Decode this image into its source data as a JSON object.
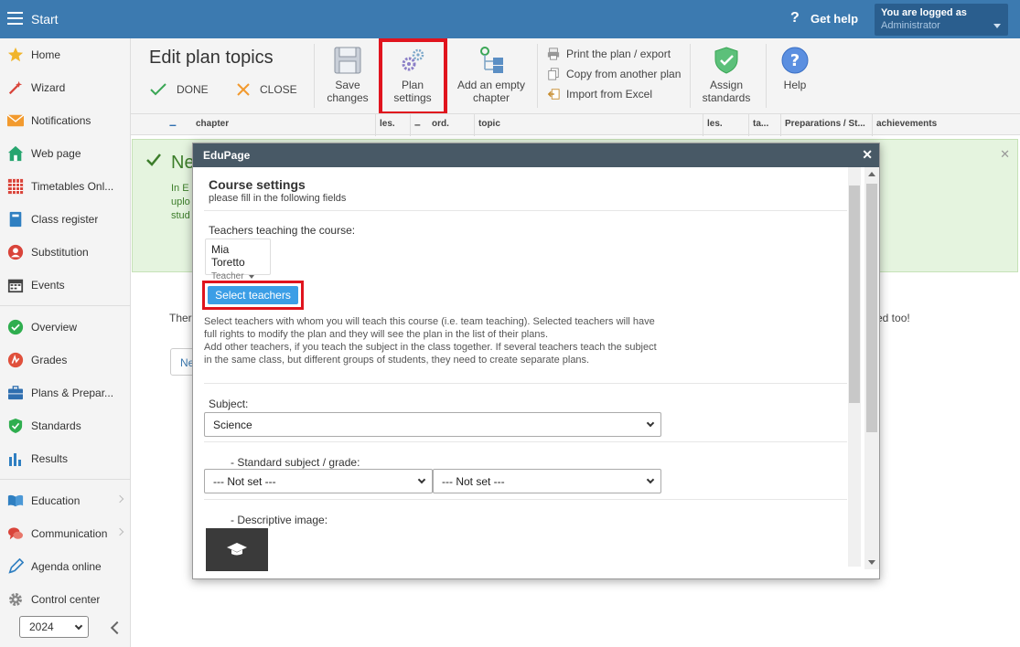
{
  "topbar": {
    "start_label": "Start",
    "help_label": "Get help",
    "logged_in_label": "You are logged as",
    "logged_in_user": "Administrator"
  },
  "sidebar": {
    "items": [
      {
        "label": "Home",
        "icon": "star-icon"
      },
      {
        "label": "Wizard",
        "icon": "wand-icon"
      },
      {
        "label": "Notifications",
        "icon": "envelope-icon"
      },
      {
        "label": "Web page",
        "icon": "house-icon"
      },
      {
        "label": "Timetables Onl...",
        "icon": "grid-icon"
      },
      {
        "label": "Class register",
        "icon": "book-icon"
      },
      {
        "label": "Substitution",
        "icon": "person-icon"
      },
      {
        "label": "Events",
        "icon": "calendar-icon"
      },
      {
        "label": "Overview",
        "icon": "check-circle-icon"
      },
      {
        "label": "Grades",
        "icon": "grade-icon"
      },
      {
        "label": "Plans & Prepar...",
        "icon": "briefcase-icon"
      },
      {
        "label": "Standards",
        "icon": "shield-icon"
      },
      {
        "label": "Results",
        "icon": "bar-chart-icon"
      },
      {
        "label": "Education",
        "icon": "open-book-icon"
      },
      {
        "label": "Communication",
        "icon": "chat-icon"
      },
      {
        "label": "Agenda online",
        "icon": "pen-icon"
      },
      {
        "label": "Control center",
        "icon": "gear-icon"
      }
    ],
    "year": "2024"
  },
  "toolbar": {
    "title": "Edit plan topics",
    "done_label": "DONE",
    "close_label": "CLOSE",
    "save_label_1": "Save",
    "save_label_2": "changes",
    "plan_label_1": "Plan",
    "plan_label_2": "settings",
    "add_label_1": "Add an empty",
    "add_label_2": "chapter",
    "print_label": "Print the plan / export",
    "copy_label": "Copy from another plan",
    "import_label": "Import from Excel",
    "assign_label_1": "Assign",
    "assign_label_2": "standards",
    "help_label": "Help"
  },
  "table_header": {
    "collapse": "–",
    "chapter": "chapter",
    "les1": "les.",
    "ord_minus": "–",
    "ord": "ord.",
    "topic": "topic",
    "les2": "les.",
    "ta": "ta...",
    "preparations": "Preparations / St...",
    "achievements": "achievements"
  },
  "background": {
    "notice_title": "Ne",
    "notice_line1": "In E",
    "notice_line2": "uplo",
    "notice_line3": "stud",
    "there_text": "Ther",
    "too_text": "ed too!",
    "new_btn": "Ne"
  },
  "modal": {
    "header": "EduPage",
    "title": "Course settings",
    "subtitle": "please fill in the following fields",
    "teachers_label": "Teachers teaching the course:",
    "teacher_name": "Mia Toretto",
    "teacher_role": "Teacher",
    "select_teachers_label": "Select teachers",
    "help_text_1": "Select teachers with whom you will teach this course (i.e. team teaching). Selected teachers will have full rights to modify the plan and they will see the plan in the list of their plans.",
    "help_text_2": "Add other teachers, if you teach the subject in the class together. If several teachers teach the subject in the same class, but different groups of students, they need to create separate plans.",
    "subject_label": "Subject:",
    "subject_value": "Science",
    "standard_label": "- Standard subject / grade:",
    "standard_value_1": "--- Not set ---",
    "standard_value_2": "--- Not set ---",
    "image_label": "- Descriptive image:"
  }
}
